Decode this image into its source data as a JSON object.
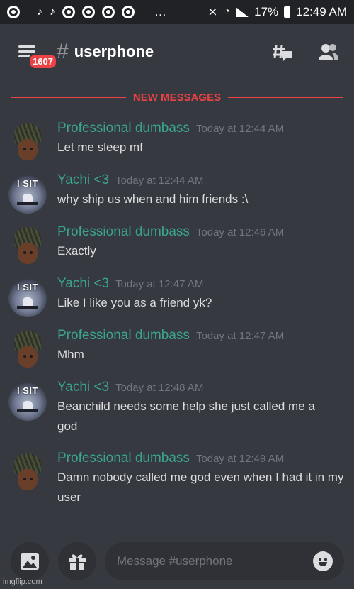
{
  "statusbar": {
    "battery": "17%",
    "time": "12:49 AM",
    "more": "…"
  },
  "header": {
    "badge": "1607",
    "hash": "#",
    "channel": "userphone"
  },
  "divider": {
    "label": "NEW MESSAGES"
  },
  "messages": [
    {
      "author": "Professional dumbass",
      "time": "Today at 12:44 AM",
      "text": "Let me sleep mf"
    },
    {
      "author": "Yachi <3",
      "time": "Today at 12:44 AM",
      "text": "why ship us when and him friends :\\"
    },
    {
      "author": "Professional dumbass",
      "time": "Today at 12:46 AM",
      "text": "Exactly"
    },
    {
      "author": "Yachi <3",
      "time": "Today at 12:47 AM",
      "text": "Like I like you as a friend yk?"
    },
    {
      "author": "Professional dumbass",
      "time": "Today at 12:47 AM",
      "text": "Mhm"
    },
    {
      "author": "Yachi <3",
      "time": "Today at 12:48 AM",
      "text": "Beanchild needs some help she just called me a god"
    },
    {
      "author": "Professional dumbass",
      "time": "Today at 12:49 AM",
      "text": "Damn nobody called me god even when I had it in my user"
    }
  ],
  "avatars": {
    "yachi_text": "I SIT"
  },
  "composer": {
    "placeholder": "Message #userphone"
  },
  "watermark": "imgflip.com",
  "colors": {
    "accent_name": "#3ba58a",
    "new_messages": "#ed4245",
    "background": "#36393f"
  }
}
